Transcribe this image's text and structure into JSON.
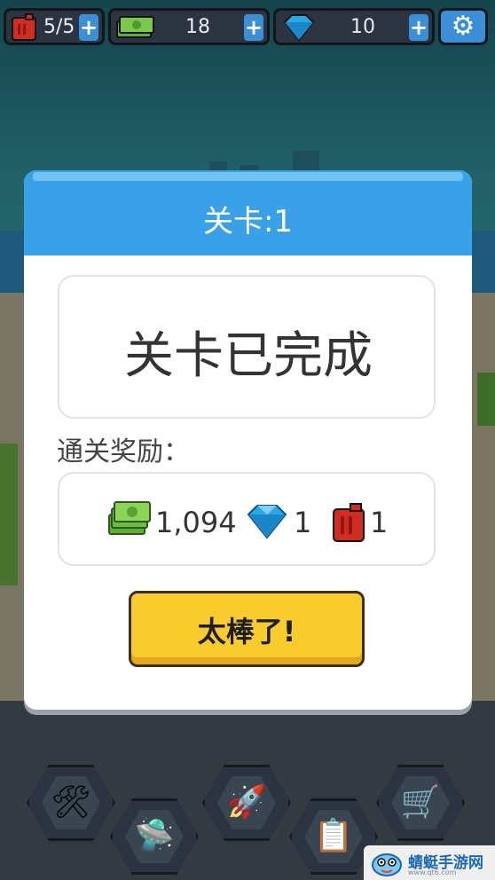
{
  "topbar": {
    "fuel": {
      "value": "5/5",
      "plus": "+",
      "icon": "fuel-can-icon"
    },
    "cash": {
      "value": "18",
      "plus": "+",
      "icon": "cash-stack-icon"
    },
    "gems": {
      "value": "10",
      "plus": "+",
      "icon": "diamond-icon"
    },
    "settings": {
      "icon": "gear-icon",
      "glyph": "⚙"
    }
  },
  "dialog": {
    "title": "关卡:1",
    "status": "关卡已完成",
    "rewards_label": "通关奖励：",
    "rewards": [
      {
        "icon": "cash-stack-icon",
        "value": "1,094"
      },
      {
        "icon": "diamond-icon",
        "value": "1"
      },
      {
        "icon": "fuel-can-icon",
        "value": "1"
      }
    ],
    "confirm_button": "太棒了!"
  },
  "bottom_nav": [
    {
      "name": "tools-icon",
      "glyph": "🛠"
    },
    {
      "name": "spaceship-icon",
      "glyph": "🛸"
    },
    {
      "name": "missile-icon",
      "glyph": "🚀"
    },
    {
      "name": "clipboard-icon",
      "glyph": "📋"
    },
    {
      "name": "cart-icon",
      "glyph": "🛒"
    }
  ],
  "watermark": {
    "text": "蜻蜓手游网",
    "sub": "www.qt6.com"
  },
  "colors": {
    "header_blue": "#3aa0e8",
    "button_yellow": "#f7cc2c",
    "plus_blue": "#3a8fd6"
  }
}
